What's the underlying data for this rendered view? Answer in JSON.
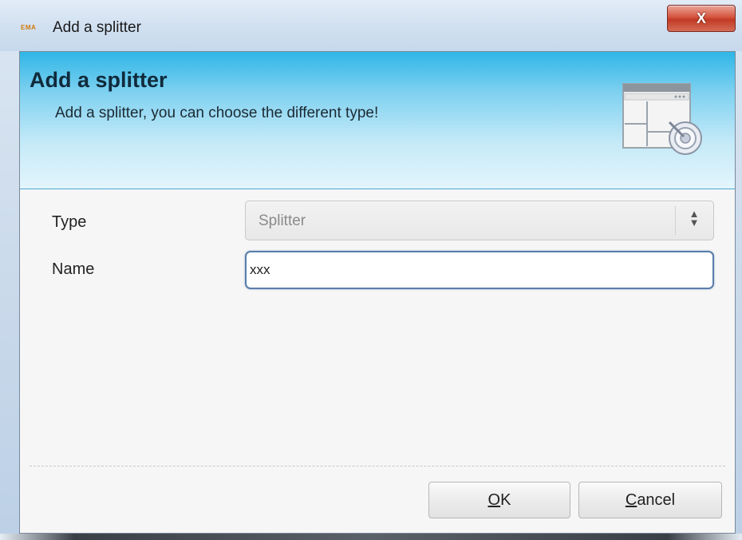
{
  "window": {
    "title": "Add a splitter",
    "app_icon_text": "EMA",
    "close_label": "X",
    "icon": "app-icon"
  },
  "banner": {
    "heading": "Add a splitter",
    "subheading": "Add a splitter, you can choose the different type!",
    "icon": "splitter-wizard-icon",
    "accent_color": "#2fb6e6"
  },
  "form": {
    "type_label": "Type",
    "type_value": "Splitter",
    "name_label": "Name",
    "name_value": "xxx"
  },
  "buttons": {
    "ok_mnemonic": "O",
    "ok_rest": "K",
    "cancel_mnemonic": "C",
    "cancel_rest": "ancel"
  }
}
